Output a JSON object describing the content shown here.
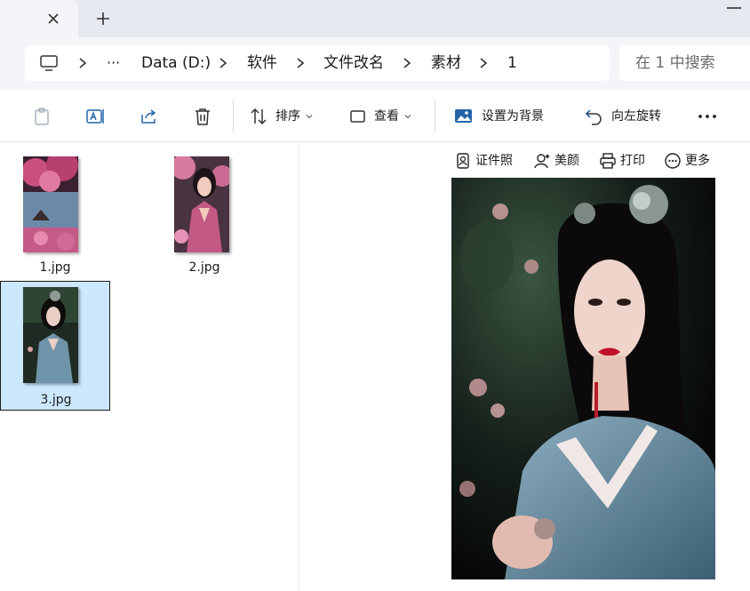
{
  "titlebar": {
    "tab_close_icon": "close-icon",
    "new_tab_icon": "plus-icon"
  },
  "address": {
    "root_icon": "computer-icon",
    "overflow": "···",
    "crumbs": [
      "Data (D:)",
      "软件",
      "文件改名",
      "素材",
      "1"
    ],
    "search_placeholder": "在 1 中搜索"
  },
  "commands": {
    "items": [
      {
        "icon": "paste-icon"
      },
      {
        "icon": "rename-icon"
      },
      {
        "icon": "share-icon"
      },
      {
        "icon": "delete-icon"
      },
      {
        "icon": "sort-icon",
        "label": "排序"
      },
      {
        "icon": "view-icon",
        "label": "查看"
      },
      {
        "icon": "wallpaper-icon",
        "label": "设置为背景"
      },
      {
        "icon": "rotate-left-icon",
        "label": "向左旋转"
      },
      {
        "icon": "more-icon"
      }
    ]
  },
  "files": [
    {
      "name": "1.jpg",
      "selected": false
    },
    {
      "name": "2.jpg",
      "selected": false
    },
    {
      "name": "3.jpg",
      "selected": true
    }
  ],
  "preview": {
    "tools": [
      {
        "icon": "id-photo-icon",
        "label": "证件照"
      },
      {
        "icon": "beauty-icon",
        "label": "美颜"
      },
      {
        "icon": "print-icon",
        "label": "打印"
      },
      {
        "icon": "more-circle-icon",
        "label": "更多"
      }
    ]
  },
  "colors": {
    "selection": "#cce8ff",
    "chrome": "#f3f5f8",
    "tabstrip": "#e6e9ef"
  }
}
